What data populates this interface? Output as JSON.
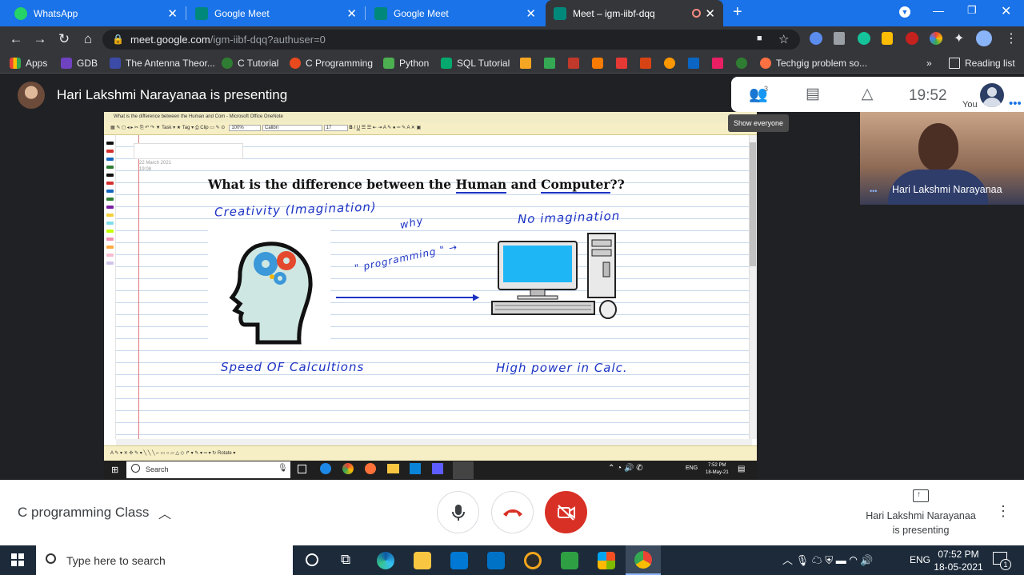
{
  "browser": {
    "tabs": [
      {
        "title": "WhatsApp",
        "color": "#25d366"
      },
      {
        "title": "Google Meet",
        "color": "#00897b"
      },
      {
        "title": "Google Meet",
        "color": "#00897b"
      },
      {
        "title": "Meet – igm-iibf-dqq",
        "color": "#00897b",
        "active": true
      }
    ],
    "url_domain": "meet.google.com",
    "url_path": "/igm-iibf-dqq?authuser=0",
    "bookmarks": [
      {
        "label": "Apps"
      },
      {
        "label": "GDB"
      },
      {
        "label": "The Antenna Theor..."
      },
      {
        "label": "C Tutorial"
      },
      {
        "label": "C Programming"
      },
      {
        "label": "Python"
      },
      {
        "label": "SQL Tutorial"
      },
      {
        "label": "Techgig problem so..."
      }
    ],
    "reading_list": "Reading list",
    "more": "»"
  },
  "meet": {
    "presenting_text": "Hari Lakshmi Narayanaa is presenting",
    "participant_count": "3",
    "clock": "19:52",
    "you_label": "You",
    "show_everyone": "Show everyone",
    "thumbnail_name": "Hari Lakshmi Narayanaa",
    "class_title": "C programming Class",
    "presenting_line1": "Hari Lakshmi Narayanaa",
    "presenting_line2": "is presenting",
    "accent": "#d93025"
  },
  "onenote": {
    "window_title": "What is the difference between the Human and  Com - Microsoft Office OneNote",
    "zoom": "100%",
    "font": "Calibri",
    "font_size": "17",
    "toolbar_task": "Task",
    "toolbar_tag": "Tag",
    "toolbar_clip": "Clip",
    "rotate": "Rotate",
    "date": "22 March 2021",
    "time": "19:08",
    "title_prefix": "What is the difference between the ",
    "title_human": "Human",
    "title_and": " and  ",
    "title_computer": "Computer",
    "title_suffix": "??",
    "hw_creativity": "Creativity (Imagination)",
    "hw_why": "why",
    "hw_programming": "\" programming \" →",
    "hw_no_imagination": "No imagination",
    "hw_speed": "Speed  OF  Calcultions",
    "hw_high_power": "High  power  in  Calc."
  },
  "inner_taskbar": {
    "search": "Search",
    "lang": "ENG",
    "time": "7:52 PM",
    "date": "18-May-21"
  },
  "win_taskbar": {
    "search_placeholder": "Type here to search",
    "lang": "ENG",
    "time": "07:52 PM",
    "date": "18-05-2021",
    "notification_count": "1"
  }
}
